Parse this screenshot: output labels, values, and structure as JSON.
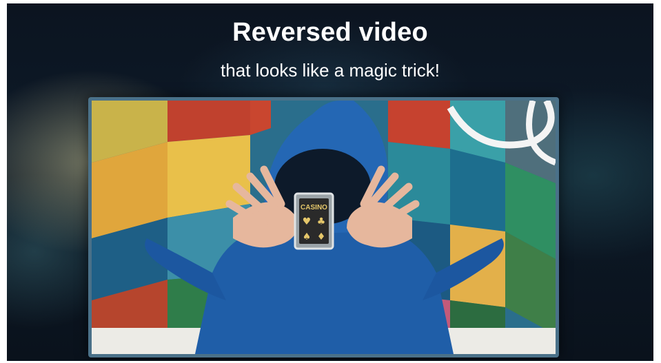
{
  "hero": {
    "title": "Reversed video",
    "subtitle": "that looks like a magic trick!"
  },
  "image": {
    "card_text": "CASINO",
    "description_icon": "magician-card-trick"
  },
  "colors": {
    "background": "#0c1420",
    "frame_border": "#4a7189",
    "hoodie_blue": "#1f5ea8",
    "text": "#ffffff"
  }
}
